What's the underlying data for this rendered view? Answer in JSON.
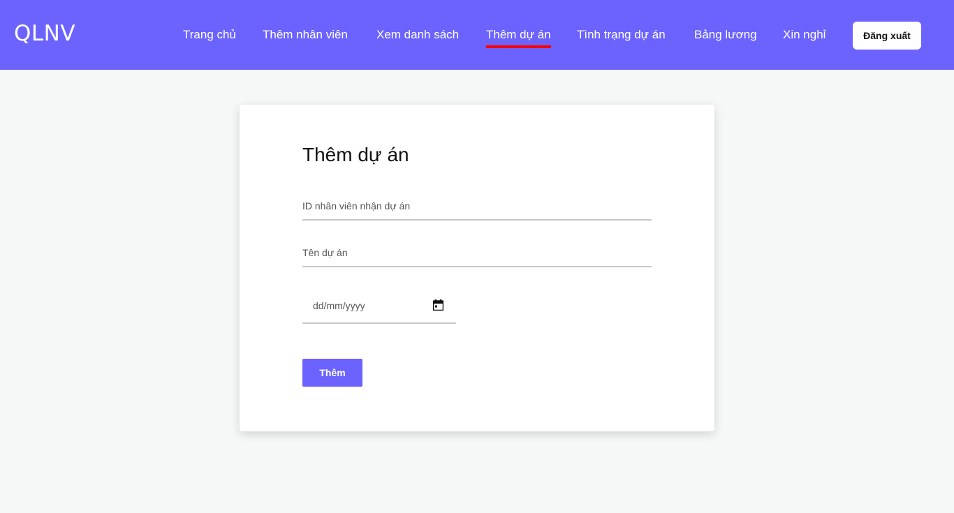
{
  "header": {
    "brand": "QLNV",
    "nav": [
      {
        "label": "Trang chủ"
      },
      {
        "label": "Thêm nhân viên"
      },
      {
        "label": "Xem danh sách"
      },
      {
        "label": "Thêm dự án",
        "active": true
      },
      {
        "label": "Tình trạng dự án"
      },
      {
        "label": "Bảng lương"
      },
      {
        "label": "Xin nghỉ"
      }
    ],
    "logout_label": "Đăng xuất"
  },
  "form": {
    "title": "Thêm dự án",
    "employee_id": {
      "placeholder": "ID nhân viên nhận dự án",
      "value": ""
    },
    "project_name": {
      "placeholder": "Tên dự án",
      "value": ""
    },
    "date": {
      "placeholder": "dd/mm/yyyy",
      "icon": "calendar-icon"
    },
    "submit_label": "Thêm"
  },
  "colors": {
    "primary": "#6c63ff",
    "active_underline": "#ff0000",
    "background": "#f6f8f8"
  }
}
